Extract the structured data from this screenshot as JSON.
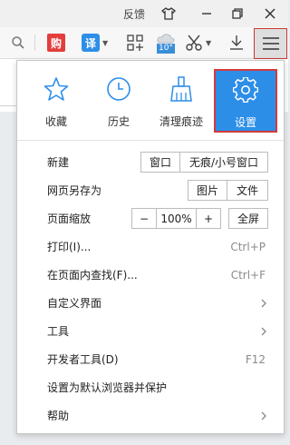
{
  "titlebar": {
    "feedback": "反馈"
  },
  "toolbar": {
    "gou_badge": "购",
    "yi_badge": "译",
    "weather_temp": "10°"
  },
  "menu": {
    "quick": [
      {
        "label": "收藏",
        "icon": "star-icon"
      },
      {
        "label": "历史",
        "icon": "clock-icon"
      },
      {
        "label": "清理痕迹",
        "icon": "broom-icon"
      },
      {
        "label": "设置",
        "icon": "gear-icon"
      }
    ],
    "new": {
      "label": "新建",
      "window": "窗口",
      "private": "无痕/小号窗口"
    },
    "save_as": {
      "label": "网页另存为",
      "image": "图片",
      "file": "文件"
    },
    "zoom": {
      "label": "页面缩放",
      "minus": "−",
      "value": "100%",
      "plus": "+",
      "fullscreen": "全屏"
    },
    "print": {
      "label": "打印(I)...",
      "shortcut": "Ctrl+P"
    },
    "find": {
      "label": "在页面内查找(F)...",
      "shortcut": "Ctrl+F"
    },
    "customize": {
      "label": "自定义界面"
    },
    "tools": {
      "label": "工具"
    },
    "devtools": {
      "label": "开发者工具(D)",
      "shortcut": "F12"
    },
    "default_browser": {
      "label": "设置为默认浏览器并保护"
    },
    "help": {
      "label": "帮助"
    }
  }
}
